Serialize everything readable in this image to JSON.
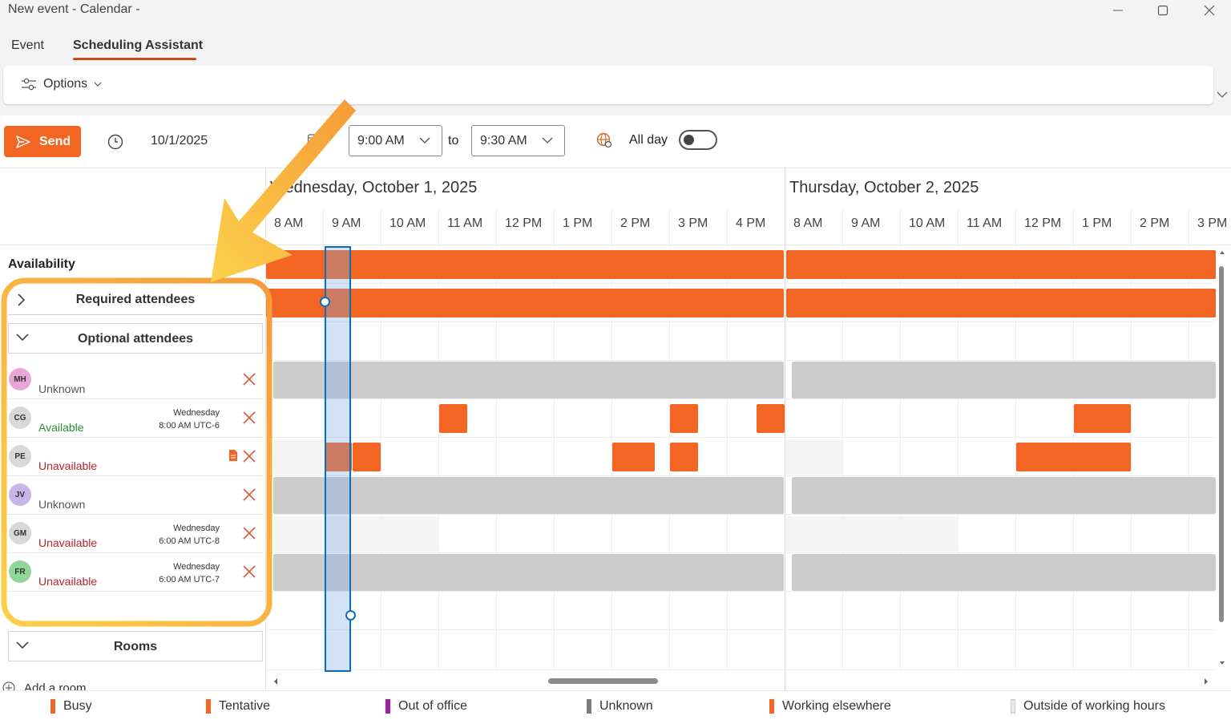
{
  "window": {
    "title": "New event - Calendar -"
  },
  "tabs": [
    {
      "label": "Event",
      "active": false
    },
    {
      "label": "Scheduling Assistant",
      "active": true
    }
  ],
  "ribbon": {
    "options_label": "Options"
  },
  "toolbar": {
    "send_label": "Send",
    "date": "10/1/2025",
    "start_time": "9:00 AM",
    "to_label": "to",
    "end_time": "9:30 AM",
    "allday_label": "All day",
    "allday_on": false
  },
  "grid": {
    "days": [
      {
        "label": "Wednesday, October 1, 2025"
      },
      {
        "label": "Thursday, October 2, 2025"
      }
    ],
    "hours": [
      "8 AM",
      "9 AM",
      "10 AM",
      "11 AM",
      "12 PM",
      "1 PM",
      "2 PM",
      "3 PM",
      "4 PM",
      "8 AM",
      "9 AM",
      "10 AM",
      "11 AM",
      "12 PM",
      "1 PM",
      "2 PM",
      "3 PM"
    ]
  },
  "availability": {
    "label": "Availability"
  },
  "groups": {
    "required_label": "Required attendees",
    "optional_label": "Optional attendees",
    "rooms_label": "Rooms",
    "add_room_label": "Add a room"
  },
  "attendees": [
    {
      "initials": "MH",
      "status": "Unknown",
      "status_color": "#555555",
      "avatar_color": "#e7a6d6",
      "tz_day": "",
      "tz_time": "",
      "note_icon": false
    },
    {
      "initials": "CG",
      "status": "Available",
      "status_color": "#2f8a2f",
      "avatar_color": "#d8d8d8",
      "tz_day": "Wednesday",
      "tz_time": "8:00 AM UTC-6",
      "note_icon": false
    },
    {
      "initials": "PE",
      "status": "Unavailable",
      "status_color": "#b0262c",
      "avatar_color": "#d8d8d8",
      "tz_day": "",
      "tz_time": "",
      "note_icon": true
    },
    {
      "initials": "JV",
      "status": "Unknown",
      "status_color": "#555555",
      "avatar_color": "#c9b5ec",
      "tz_day": "",
      "tz_time": "",
      "note_icon": false
    },
    {
      "initials": "GM",
      "status": "Unavailable",
      "status_color": "#b0262c",
      "avatar_color": "#d8d8d8",
      "tz_day": "Wednesday",
      "tz_time": "6:00 AM UTC-8",
      "note_icon": false
    },
    {
      "initials": "FR",
      "status": "Unavailable",
      "status_color": "#b0262c",
      "avatar_color": "#8fd69a",
      "tz_day": "Wednesday",
      "tz_time": "6:00 AM UTC-7",
      "note_icon": false
    }
  ],
  "legend": [
    {
      "label": "Busy",
      "color": "#f26522"
    },
    {
      "label": "Tentative",
      "color": "#f26522"
    },
    {
      "label": "Out of office",
      "color": "#a31fa3"
    },
    {
      "label": "Unknown",
      "color": "#7a7a7a"
    },
    {
      "label": "Working elsewhere",
      "color": "#f26522"
    },
    {
      "label": "Outside of working hours",
      "color": "#e8e8e8"
    }
  ],
  "colors": {
    "busy": "#f26522",
    "unknown": "#cccccc",
    "outside_hours": "#f4f4f4",
    "accent": "#f26522",
    "selection": "#0f6cbd",
    "highlight_arrow": "#f7a23a"
  }
}
